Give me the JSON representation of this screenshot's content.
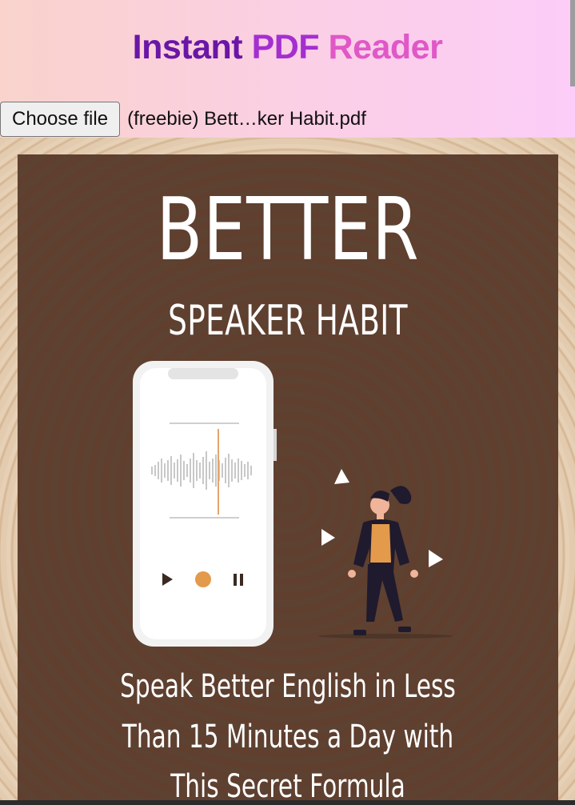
{
  "app": {
    "title_part1": "Instant",
    "title_part2": "PDF",
    "title_part3": "Reader",
    "colors": {
      "title1": "#6a16a6",
      "title2": "#a42fd0",
      "title3": "#e058c7"
    }
  },
  "file_input": {
    "button_label": "Choose file",
    "file_name": "(freebie) Bett…ker Habit.pdf"
  },
  "document": {
    "cover": {
      "title": "BETTER",
      "subtitle": "SPEAKER HABIT",
      "tagline_line1": "Speak Better English in Less",
      "tagline_line2": "Than 15 Minutes a Day with",
      "tagline_line3": "This Secret Formula"
    },
    "icons": [
      "phone-illustration",
      "sound-wave-icon",
      "play-icon",
      "record-icon",
      "pause-icon",
      "person-illustration",
      "triangle-decoration-icon"
    ]
  }
}
